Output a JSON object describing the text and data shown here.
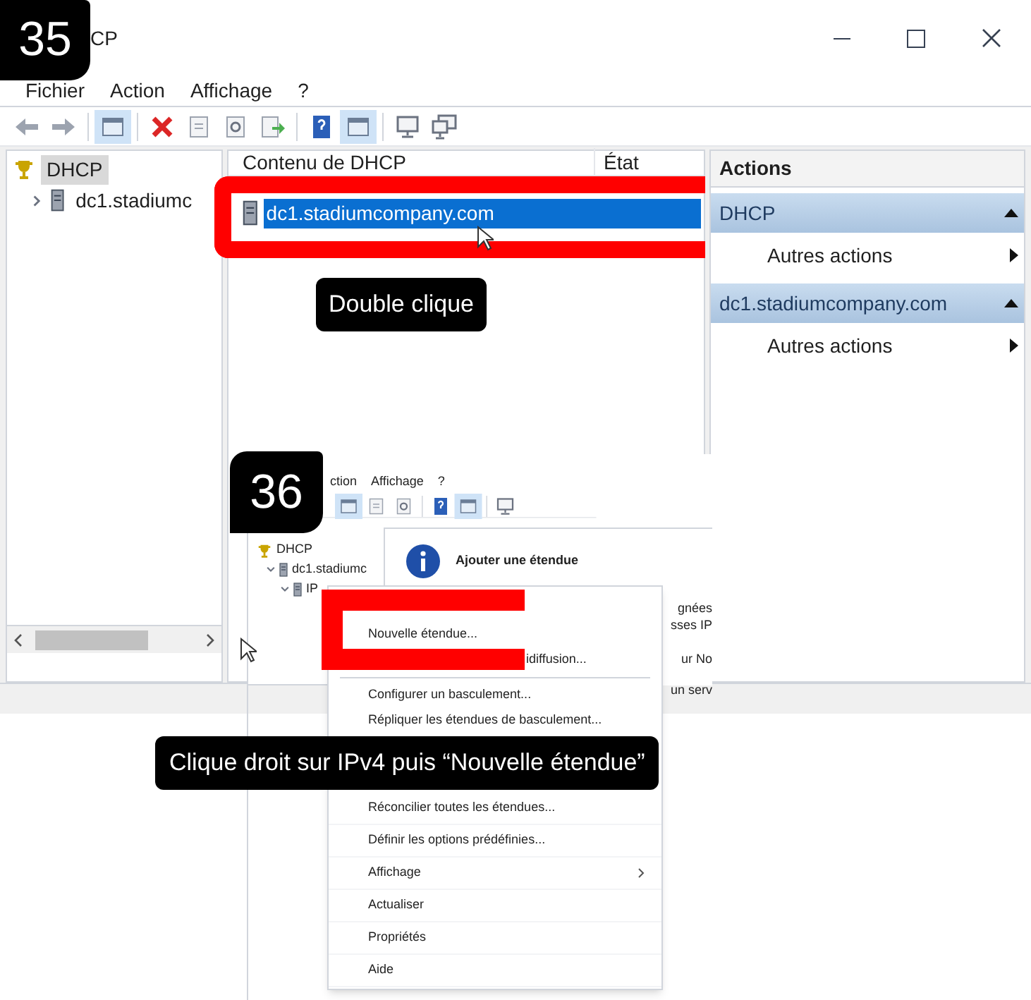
{
  "window": {
    "title": "CP",
    "step_badge": "35",
    "menu": [
      "Fichier",
      "Action",
      "Affichage",
      "?"
    ],
    "tree": [
      {
        "label": "DHCP",
        "selected": true,
        "children": [
          {
            "label": "dc1.stadiumc",
            "expanded": false
          }
        ]
      }
    ],
    "content": {
      "columns": [
        "Contenu de DHCP",
        "État"
      ],
      "rows": [
        {
          "label": "dc1.stadiumcompany.com",
          "selected": true
        }
      ]
    },
    "actions": {
      "title": "Actions",
      "sections": [
        {
          "title": "DHCP",
          "items": [
            "Autres actions"
          ]
        },
        {
          "title": "dc1.stadiumcompany.com",
          "items": [
            "Autres actions"
          ]
        }
      ]
    },
    "caption": "Double clique"
  },
  "inset": {
    "step_badge": "36",
    "menu": [
      "ction",
      "Affichage",
      "?"
    ],
    "tree": [
      {
        "label": "DHCP",
        "children": [
          {
            "label": "dc1.stadiumc",
            "expanded": true,
            "children": [
              {
                "label": "IP",
                "expanded": true
              }
            ]
          }
        ]
      }
    ],
    "info_title": "Ajouter une étendue",
    "clipped_texts": [
      "gnées",
      "sses IP",
      "ur No",
      "un serv"
    ],
    "context_menu": {
      "top_items": [
        {
          "label": "Nouvelle étendue...",
          "kind": "item"
        },
        {
          "label": "idiffusion...",
          "kind": "clipped"
        },
        {
          "kind": "separator"
        },
        {
          "label": "Configurer un basculement...",
          "kind": "item"
        },
        {
          "label": "Répliquer les étendues de basculement...",
          "kind": "item"
        }
      ],
      "bottom_items": [
        {
          "label": "Réconcilier toutes les étendues...",
          "kind": "item"
        },
        {
          "label": "Définir les options prédéfinies...",
          "kind": "item"
        },
        {
          "label": "Affichage",
          "kind": "submenu"
        },
        {
          "label": "Actualiser",
          "kind": "item"
        },
        {
          "label": "Propriétés",
          "kind": "item"
        },
        {
          "label": "Aide",
          "kind": "item"
        }
      ]
    },
    "caption": "Clique droit sur IPv4 puis “Nouvelle étendue”"
  }
}
